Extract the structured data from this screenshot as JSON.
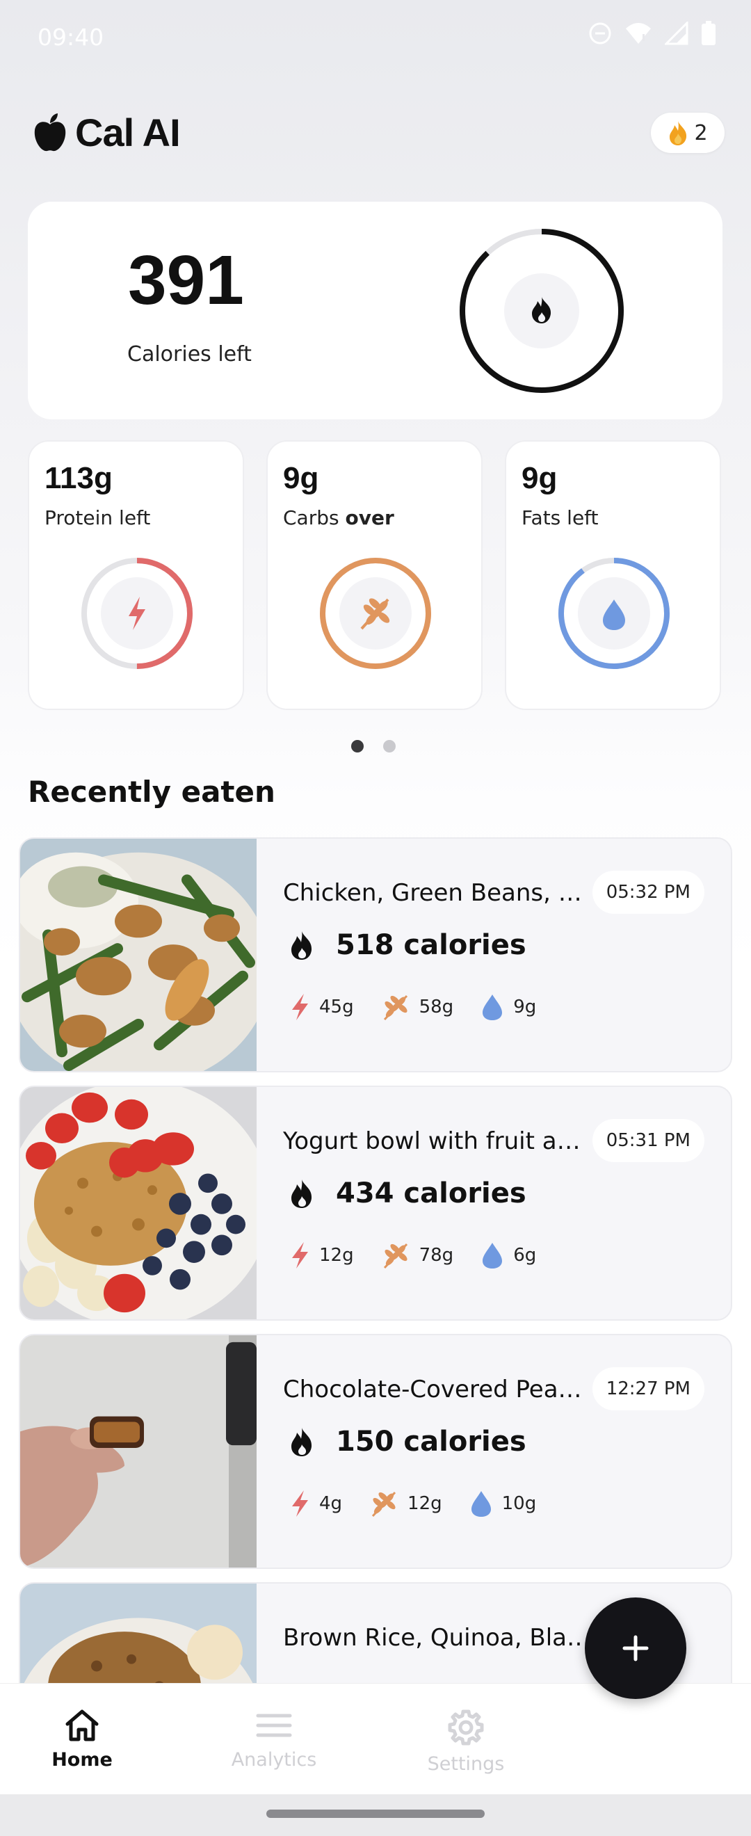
{
  "status_bar": {
    "time": "09:40"
  },
  "header": {
    "app_name": "Cal AI",
    "streak_count": "2"
  },
  "calories": {
    "value": "391",
    "label": "Calories left",
    "progress_fraction": 0.88
  },
  "macros": [
    {
      "value": "113g",
      "label": "Protein left",
      "label_emph": "",
      "icon": "lightning-icon",
      "color": "#e06a6a",
      "progress_fraction": 0.5
    },
    {
      "value": "9g",
      "label": "Carbs ",
      "label_emph": "over",
      "icon": "wheat-icon",
      "color": "#e0965e",
      "progress_fraction": 1.0
    },
    {
      "value": "9g",
      "label": "Fats left",
      "label_emph": "",
      "icon": "droplet-icon",
      "color": "#6f99e0",
      "progress_fraction": 0.9
    }
  ],
  "pager": {
    "count": 2,
    "active": 0
  },
  "recent": {
    "title": "Recently eaten",
    "items": [
      {
        "name": "Chicken, Green Beans, …",
        "time": "05:32 PM",
        "calories": "518 calories",
        "protein": "45g",
        "carbs": "58g",
        "fat": "9g"
      },
      {
        "name": "Yogurt bowl with fruit a…",
        "time": "05:31 PM",
        "calories": "434 calories",
        "protein": "12g",
        "carbs": "78g",
        "fat": "6g"
      },
      {
        "name": "Chocolate-Covered Pea…",
        "time": "12:27 PM",
        "calories": "150 calories",
        "protein": "4g",
        "carbs": "12g",
        "fat": "10g"
      },
      {
        "name": "Brown Rice, Quinoa, Blac…",
        "time": "",
        "calories": "",
        "protein": "",
        "carbs": "",
        "fat": ""
      }
    ]
  },
  "nav": {
    "home": "Home",
    "analytics": "Analytics",
    "settings": "Settings"
  },
  "colors": {
    "protein": "#e06a6a",
    "carbs": "#e0965e",
    "fat": "#6f99e0",
    "fab": "#141418"
  }
}
